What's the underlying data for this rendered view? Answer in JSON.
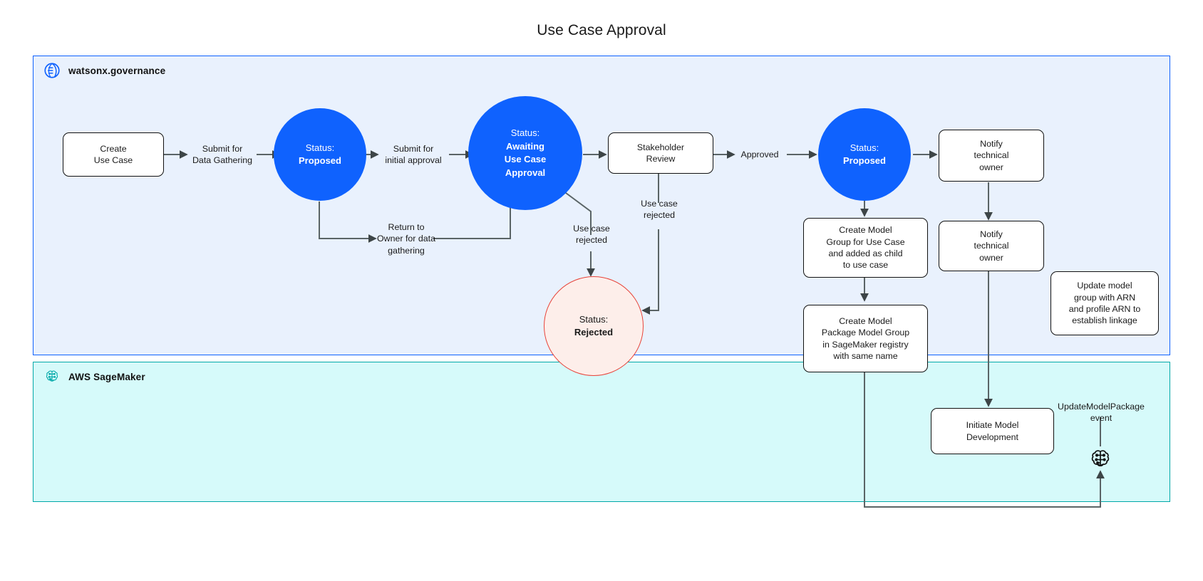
{
  "title": "Use Case Approval",
  "colors": {
    "governance_fill": "#e9f1fd",
    "governance_border": "#0f62fe",
    "sagemaker_fill": "#d6fafa",
    "sagemaker_border": "#00a8a8",
    "status_blue": "#0f62fe",
    "rejected_fill": "#fdeeea",
    "rejected_border": "#e8443a",
    "connector": "#5a6466",
    "node_border": "#111111"
  },
  "lanes": [
    {
      "id": "watsonx-governance",
      "title": "watsonx.governance",
      "icon": "watsonx-globe-icon"
    },
    {
      "id": "aws-sagemaker",
      "title": "AWS SageMaker",
      "icon": "sagemaker-brain-icon"
    }
  ],
  "nodes": [
    {
      "id": "create-use-case",
      "shape": "box",
      "text": "Create\nUse Case"
    },
    {
      "id": "status-proposed-1",
      "shape": "circle",
      "line1": "Status:",
      "line2": "Proposed"
    },
    {
      "id": "status-awaiting",
      "shape": "circle",
      "line1": "Status:",
      "line2": "Awaiting\nUse Case\nApproval"
    },
    {
      "id": "stakeholder-review",
      "shape": "box",
      "text": "Stakeholder\nReview"
    },
    {
      "id": "status-proposed-2",
      "shape": "circle",
      "line1": "Status:",
      "line2": "Proposed"
    },
    {
      "id": "status-rejected",
      "shape": "circle",
      "line1": "Status:",
      "line2": "Rejected"
    },
    {
      "id": "notify-technical-owner-1",
      "shape": "box",
      "text": "Notify\ntechnical\nowner"
    },
    {
      "id": "notify-technical-owner-2",
      "shape": "box",
      "text": "Notify\ntechnical\nowner"
    },
    {
      "id": "create-model-group",
      "shape": "box",
      "text": "Create Model\nGroup for Use Case\nand added as child\nto use case"
    },
    {
      "id": "create-model-package",
      "shape": "box",
      "text": "Create Model\nPackage Model Group\nin SageMaker registry\nwith same name"
    },
    {
      "id": "update-model-group-arn",
      "shape": "box",
      "text": "Update model\ngroup with ARN\nand profile ARN to\nestablish linkage"
    },
    {
      "id": "initiate-model-development",
      "shape": "box",
      "text": "Initiate Model\nDevelopment"
    }
  ],
  "edge_labels": [
    {
      "id": "submit-for-data-gathering",
      "text": "Submit for\nData Gathering"
    },
    {
      "id": "submit-for-initial-approval",
      "text": "Submit for\ninitial approval"
    },
    {
      "id": "return-to-owner",
      "text": "Return to\nOwner for data\ngathering"
    },
    {
      "id": "use-case-rejected-1",
      "text": "Use case\nrejected"
    },
    {
      "id": "use-case-rejected-2",
      "text": "Use case\nrejected"
    },
    {
      "id": "approved",
      "text": "Approved"
    },
    {
      "id": "update-model-package-event",
      "text": "UpdateModelPackage\nevent"
    }
  ],
  "icons": {
    "sagemaker_endpoint": "brain-icon"
  }
}
